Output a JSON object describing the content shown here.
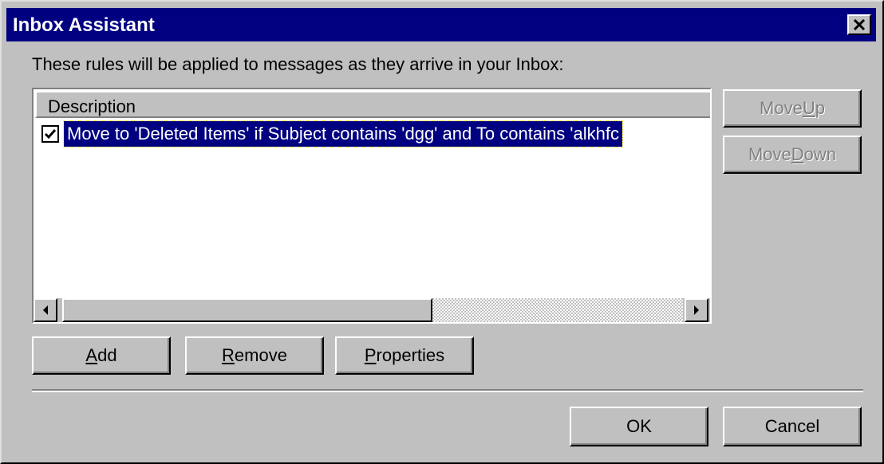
{
  "window": {
    "title": "Inbox Assistant",
    "close_icon": "close-x-icon"
  },
  "instruction": "These rules will be applied to messages as they arrive in your Inbox:",
  "rules_list": {
    "column_header": "Description",
    "rules": [
      {
        "checked": true,
        "description": "Move to 'Deleted Items'  if Subject contains 'dgg' and To contains 'alkhfc",
        "selected": true
      }
    ]
  },
  "side_buttons": {
    "move_up": {
      "accel": "U",
      "label_pre": "Move ",
      "label_post": "p",
      "enabled": false
    },
    "move_down": {
      "accel": "D",
      "label_pre": "Move ",
      "label_post": "own",
      "enabled": false
    }
  },
  "action_buttons": {
    "add": {
      "accel": "A",
      "rest": "dd"
    },
    "remove": {
      "accel": "R",
      "rest": "emove"
    },
    "properties": {
      "accel": "P",
      "rest": "roperties"
    }
  },
  "footer_buttons": {
    "ok": "OK",
    "cancel": "Cancel"
  },
  "colors": {
    "face": "#c0c0c0",
    "title_bar": "#000080",
    "selection": "#000080"
  }
}
